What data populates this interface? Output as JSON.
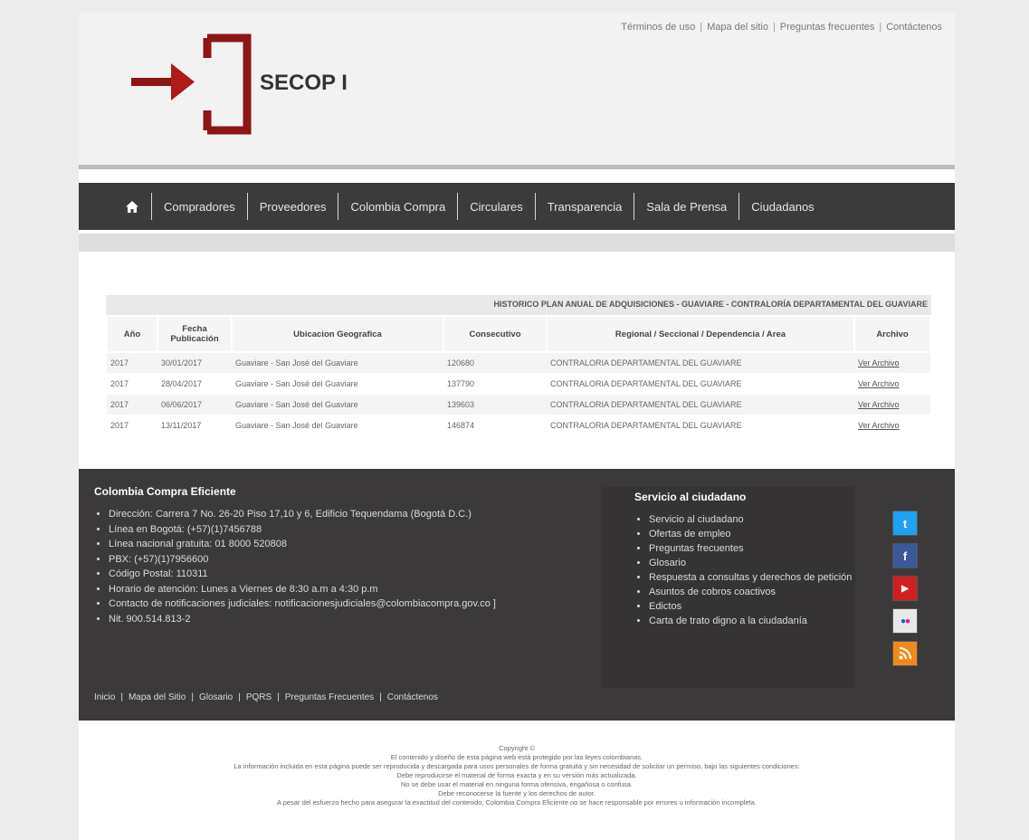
{
  "top_links": [
    "Términos de uso",
    "Mapa del sitio",
    "Preguntas frecuentes",
    "Contáctenos"
  ],
  "brand": "SECOP I",
  "nav": {
    "home_icon": "home-icon",
    "items": [
      "Compradores",
      "Proveedores",
      "Colombia Compra",
      "Circulares",
      "Transparencia",
      "Sala de Prensa",
      "Ciudadanos"
    ]
  },
  "table": {
    "caption": "HISTORICO PLAN ANUAL DE ADQUISICIONES - GUAVIARE - CONTRALORÍA DEPARTAMENTAL DEL GUAVIARE",
    "headers": [
      "Año",
      "Fecha Publicación",
      "Ubicacion Geografica",
      "Consecutivo",
      "Regional / Seccional / Dependencia / Area",
      "Archivo"
    ],
    "rows": [
      [
        "2017",
        "30/01/2017",
        "Guaviare - San José del Guaviare",
        "120680",
        "CONTRALORIA DEPARTAMENTAL DEL GUAVIARE",
        "Ver Archivo"
      ],
      [
        "2017",
        "28/04/2017",
        "Guaviare - San José del Guaviare",
        "137790",
        "CONTRALORIA DEPARTAMENTAL DEL GUAVIARE",
        "Ver Archivo"
      ],
      [
        "2017",
        "06/06/2017",
        "Guaviare - San José del Guaviare",
        "139603",
        "CONTRALORIA DEPARTAMENTAL DEL GUAVIARE",
        "Ver Archivo"
      ],
      [
        "2017",
        "13/11/2017",
        "Guaviare - San José del Guaviare",
        "146874",
        "CONTRALORIA DEPARTAMENTAL DEL GUAVIARE",
        "Ver Archivo"
      ]
    ]
  },
  "footer": {
    "col1_title": "Colombia Compra Eficiente",
    "col1_items": [
      "Dirección: Carrera 7 No. 26-20 Piso 17,10 y 6, Edificio Tequendama (Bogotá D.C.)",
      "Línea en Bogotá: (+57)(1)7456788",
      "Línea nacional gratuita: 01 8000 520808",
      "PBX: (+57)(1)7956600",
      "Código Postal: 110311",
      "Horario de atención: Lunes a Viernes de 8:30 a.m a 4:30 p.m",
      "Contacto de notificaciones judiciales:   notificacionesjudiciales@colombiacompra.gov.co  ]",
      "Nit. 900.514.813-2"
    ],
    "col2_title": "Servicio al ciudadano",
    "col2_items": [
      "Servicio al ciudadano",
      "Ofertas de empleo",
      "Preguntas frecuentes",
      "Glosario",
      "Respuesta a consultas y derechos de petición",
      "Asuntos de cobros coactivos",
      "Edictos",
      "Carta de trato digno a la ciudadanía"
    ],
    "social": [
      {
        "icon": "twitter-icon",
        "glyph": "t",
        "color": "#1da1f2"
      },
      {
        "icon": "facebook-icon",
        "glyph": "f",
        "color": "#3b5998"
      },
      {
        "icon": "youtube-icon",
        "glyph": "▶",
        "color": "#d01f1f"
      },
      {
        "icon": "flickr-icon",
        "glyph": "●●",
        "color": "#e8e8e8"
      },
      {
        "icon": "rss-icon",
        "glyph": ")",
        "color": "#f08a1c"
      }
    ],
    "bottom_links": [
      "Inicio",
      "Mapa del Sitio",
      "Glosario",
      "PQRS",
      "Preguntas Frecuentes",
      "Contáctenos"
    ]
  },
  "copyright": [
    "Copyright ©",
    "El contenido y diseño de esta página web está protegido por las leyes colombianas.",
    "La información incluida en esta página puede ser reproducida y descargada para usos personales de forma gratuita y sin necesidad de solicitar un permiso, bajo las siguientes condiciones:",
    "Debe reproducirse el material de forma exacta y en su versión más actualizada.",
    "No se debe usar el material en ninguna forma ofensiva, engañosa o confusa.",
    "Debe reconocerse la fuente y los derechos de autor.",
    "A pesar del esfuerzo hecho para asegurar la exactitud del contenido, Colombia Compra Eficiente no se hace responsable por errores u información incompleta."
  ]
}
